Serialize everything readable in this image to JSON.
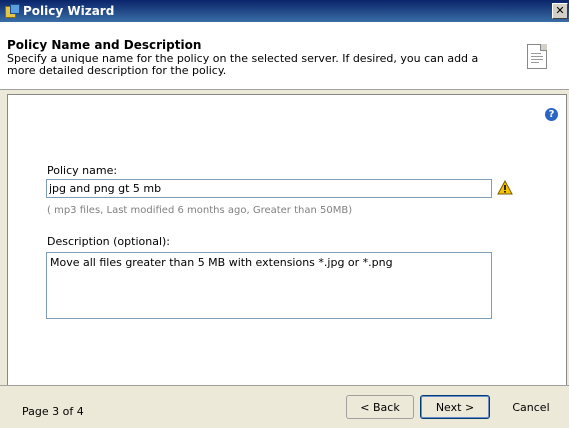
{
  "window": {
    "title": "Policy Wizard",
    "close_symbol": "✕"
  },
  "header": {
    "title": "Policy Name and Description",
    "description": "Specify a unique name for the policy on the selected server. If desired, you can add a more detailed description for the policy.",
    "icon": "document-icon"
  },
  "form": {
    "help_symbol": "?",
    "policy_name_label": "Policy name:",
    "policy_name_value": "jpg and png gt 5 mb",
    "warning_icon": "warning-icon",
    "policy_hint": "( mp3 files, Last modified  6 months ago, Greater than 50MB)",
    "description_label": "Description (optional):",
    "description_value": "Move all files greater than 5 MB with extensions *.jpg or *.png"
  },
  "footer": {
    "page_indicator": "Page 3 of 4",
    "back_label": "< Back",
    "next_label": "Next >",
    "cancel_label": "Cancel"
  },
  "colors": {
    "titlebar": "#0a246a",
    "warning": "#f5c400",
    "help": "#2a64c4"
  }
}
